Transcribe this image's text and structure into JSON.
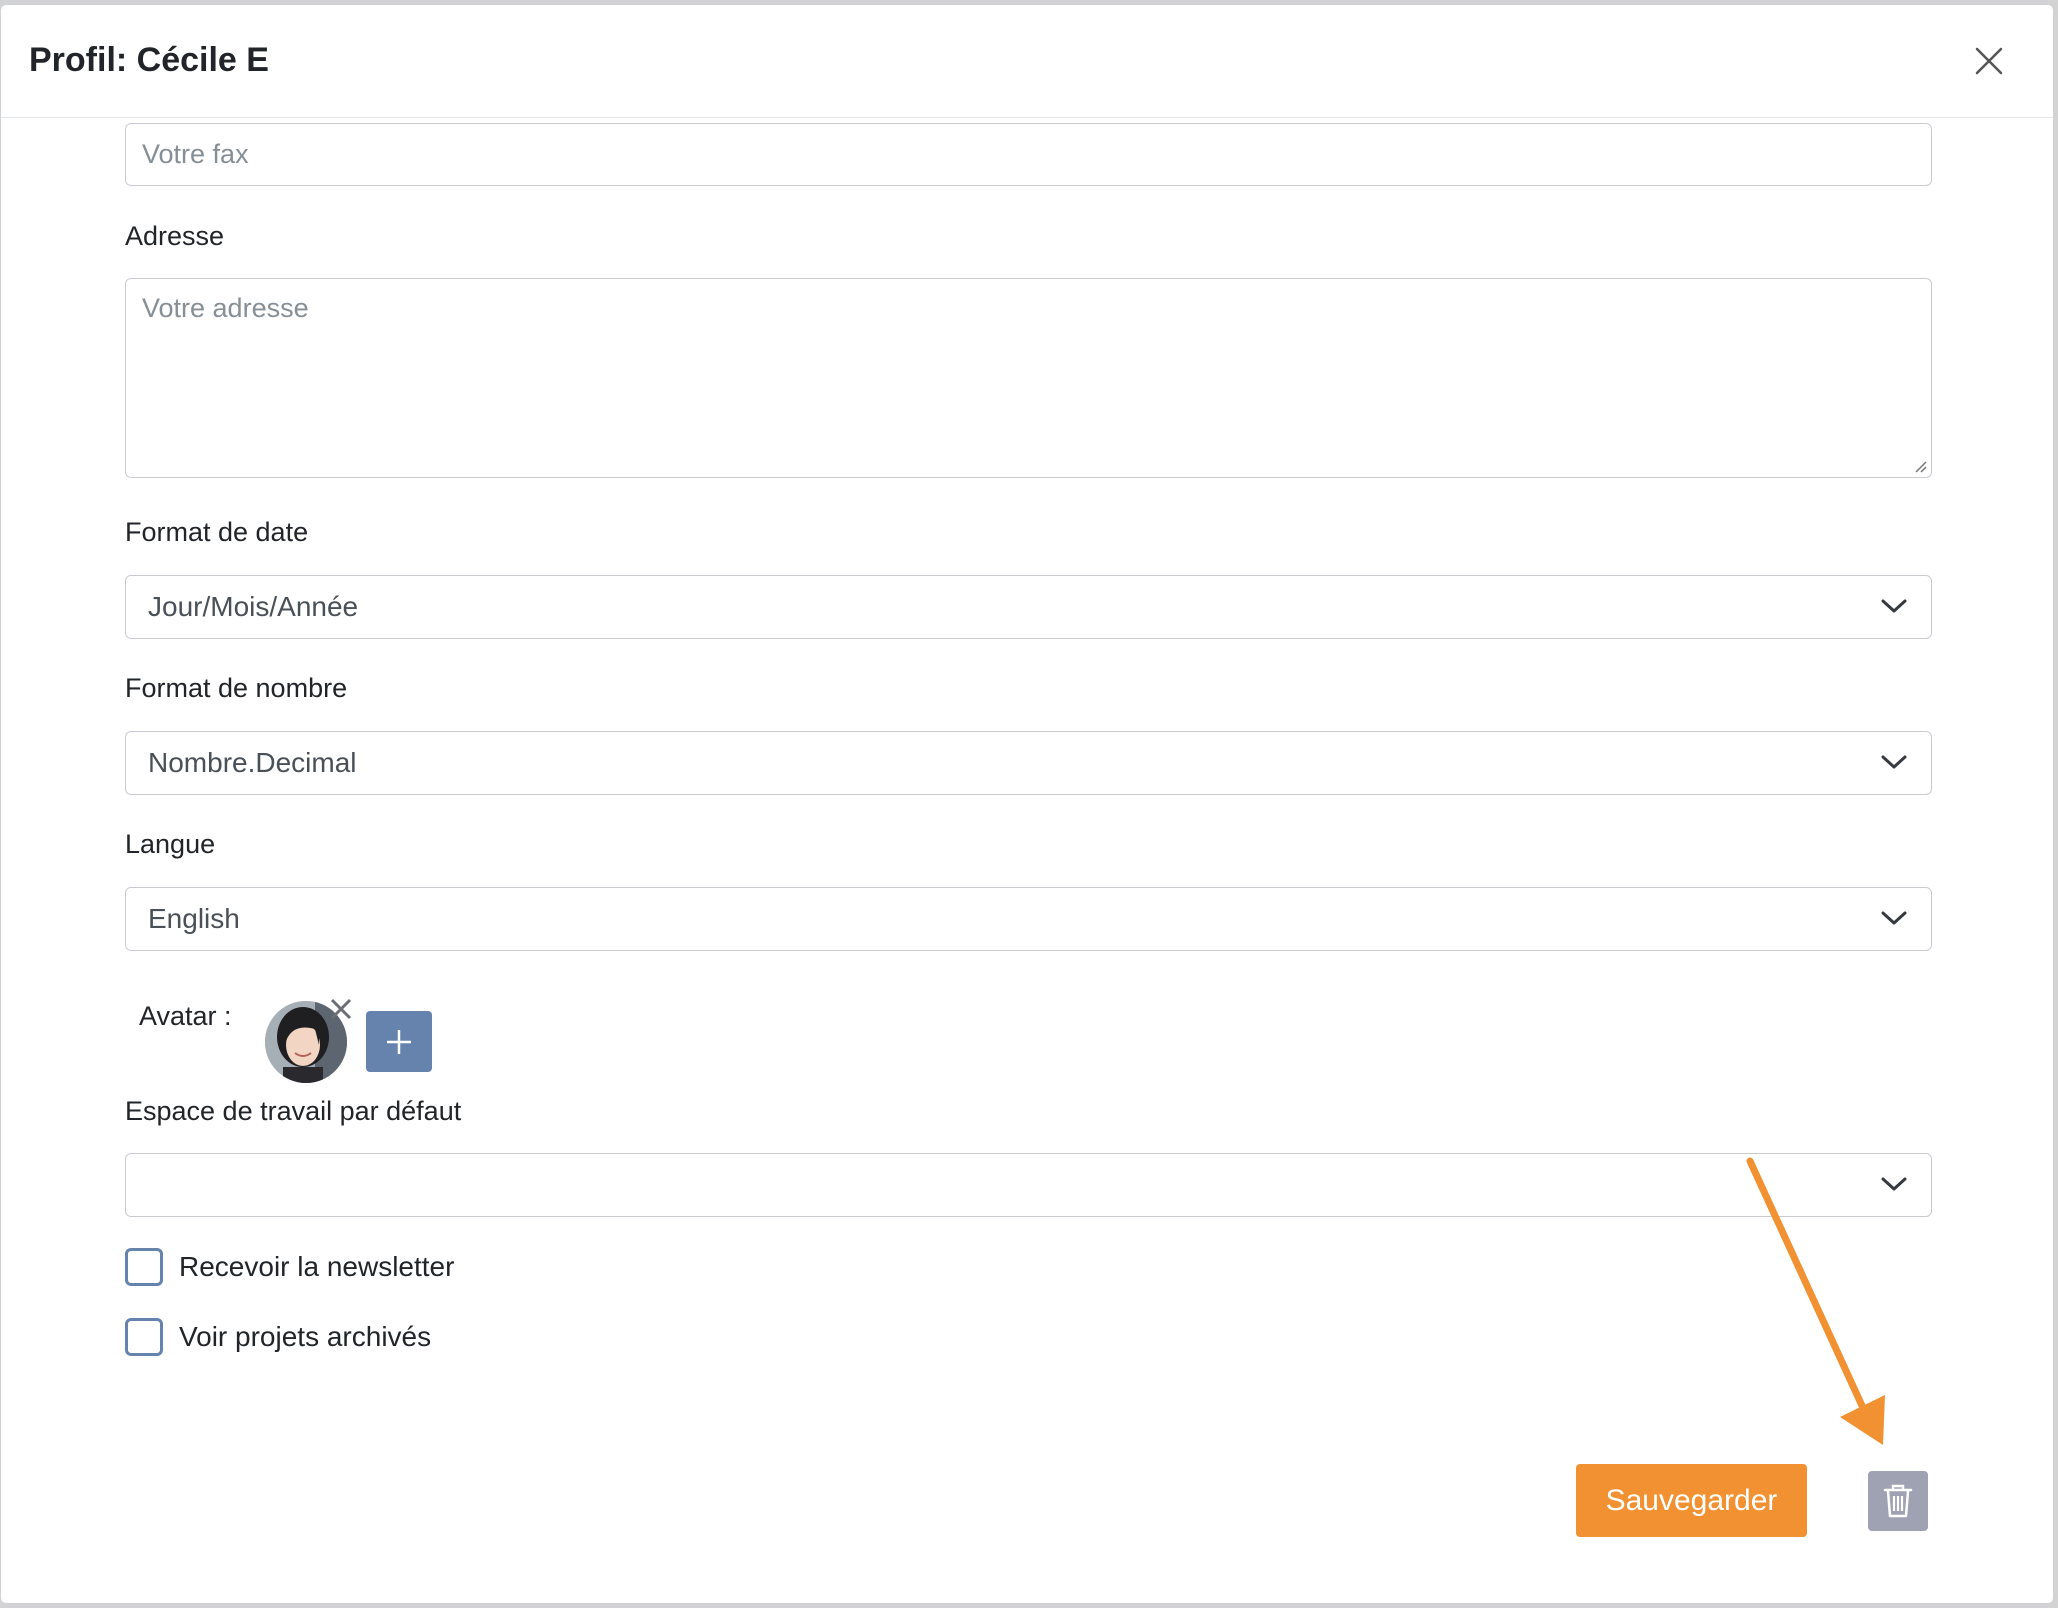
{
  "modal": {
    "title": "Profil: Cécile E",
    "close_icon": "close-icon"
  },
  "form": {
    "fax": {
      "value": "",
      "placeholder": "Votre fax"
    },
    "address": {
      "label": "Adresse",
      "value": "",
      "placeholder": "Votre adresse"
    },
    "date_format": {
      "label": "Format de date",
      "selected": "Jour/Mois/Année"
    },
    "number_format": {
      "label": "Format de nombre",
      "selected": "Nombre.Decimal"
    },
    "language": {
      "label": "Langue",
      "selected": "English"
    },
    "avatar": {
      "label": "Avatar :",
      "remove_icon": "close-icon",
      "add_icon": "plus-icon"
    },
    "default_workspace": {
      "label": "Espace de travail par défaut",
      "selected": ""
    },
    "newsletter": {
      "label": "Recevoir la newsletter",
      "checked": false
    },
    "archived_projects": {
      "label": "Voir projets archivés",
      "checked": false
    }
  },
  "footer": {
    "save_label": "Sauvegarder",
    "delete_icon": "trash-icon"
  },
  "annotation": {
    "arrow_color": "#f19132"
  },
  "colors": {
    "accent": "#f19132",
    "primary": "#6583ad",
    "delete": "#9fa2b3"
  }
}
